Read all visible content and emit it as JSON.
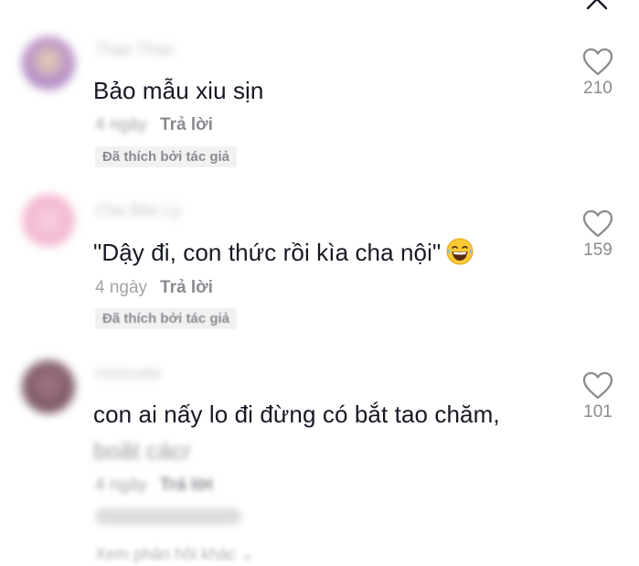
{
  "comments": [
    {
      "username": "Thao Thao",
      "text": "Bảo mẫu xiu sịn",
      "date": "4 ngày",
      "reply_label": "Trả lời",
      "liked_by_author": "Đã thích bởi tác giả",
      "likes": "210"
    },
    {
      "username": "Cha Bảo Lý",
      "text": "\"Dậy đi, con thức rồi kìa cha nội\"",
      "emoji": "laughing-emoji",
      "date": "4 ngày",
      "reply_label": "Trả lời",
      "liked_by_author": "Đã thích bởi tác giả",
      "likes": "159"
    },
    {
      "username": "moncutie",
      "text": "con ai nấy lo đi đừng có bắt tao chăm,",
      "text_line2": "boăt cácr",
      "date": "4 ngày",
      "reply_label": "Trả lời",
      "view_more": "Xem phản hồi khác",
      "likes": "101"
    }
  ],
  "icons": {
    "close": "close-icon",
    "like": "heart-outline-icon"
  },
  "colors": {
    "text": "#161823",
    "secondary": "#8a8b91",
    "muted": "#a3a3a8"
  }
}
